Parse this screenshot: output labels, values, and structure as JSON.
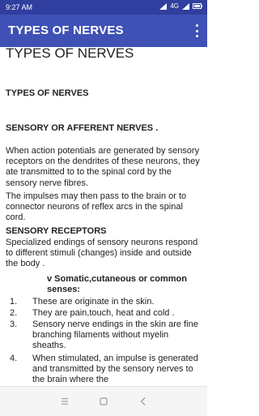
{
  "status_bar": {
    "time": "9:27 AM",
    "network": "4G"
  },
  "app_bar": {
    "title": "TYPES OF NERVES"
  },
  "content": {
    "doc_title": "TYPES OF NERVES",
    "heading1": "TYPES OF NERVES",
    "heading2": "SENSORY OR AFFERENT NERVES .",
    "para1": "  When action potentials are generated by sensory receptors on the dendrites of these neurons, they ate transmitted to to the spinal cord by the sensory nerve fibres.",
    "para2": "  The impulses may then pass to the brain or to connector neurons of reflex arcs in the spinal cord.",
    "heading3": "SENSORY RECEPTORS",
    "para3": "  Specialized endings of sensory neurons respond to different stimuli (changes) inside and outside the body .",
    "bullet": "v  Somatic,cutaneous or common senses:",
    "list": [
      {
        "num": "1.",
        "text": "  These are originate in the skin."
      },
      {
        "num": "2.",
        "text": "  They are pain,touch, heat and cold ."
      },
      {
        "num": "3.",
        "text": "  Sensory nerve endings in the skin are fine branching filaments without myelin sheaths."
      },
      {
        "num": "4.",
        "text": "  When stimulated, an impulse is generated and transmitted by the sensory nerves to the brain where the"
      }
    ]
  },
  "colors": {
    "status_bar": "#303f9f",
    "app_bar": "#3f51b5"
  }
}
